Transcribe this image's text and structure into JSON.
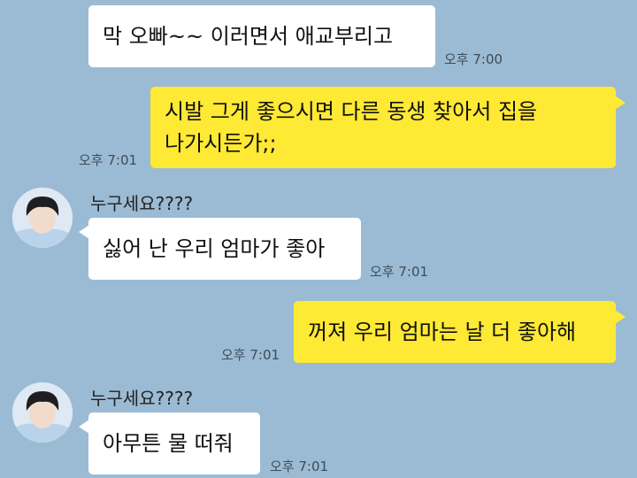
{
  "chat": {
    "messages": [
      {
        "text": "막 오빠~~ 이러면서 애교부리고",
        "time": "오후 7:00"
      },
      {
        "text": "시발 그게 좋으시면 다른 동생 찾아서 집을\n나가시든가;;",
        "time": "오후 7:01"
      },
      {
        "sender": "누구세요????",
        "text": "싫어 난 우리 엄마가 좋아",
        "time": "오후 7:01"
      },
      {
        "text": "꺼져 우리 엄마는 날 더 좋아해",
        "time": "오후 7:01"
      },
      {
        "sender": "누구세요????",
        "text": "아무튼 물 떠줘",
        "time": "오후 7:01"
      }
    ]
  },
  "colors": {
    "background": "#9bbbd4",
    "incoming_bubble": "#ffffff",
    "outgoing_bubble": "#fee934"
  },
  "icons": {
    "avatar": "profile-photo"
  }
}
